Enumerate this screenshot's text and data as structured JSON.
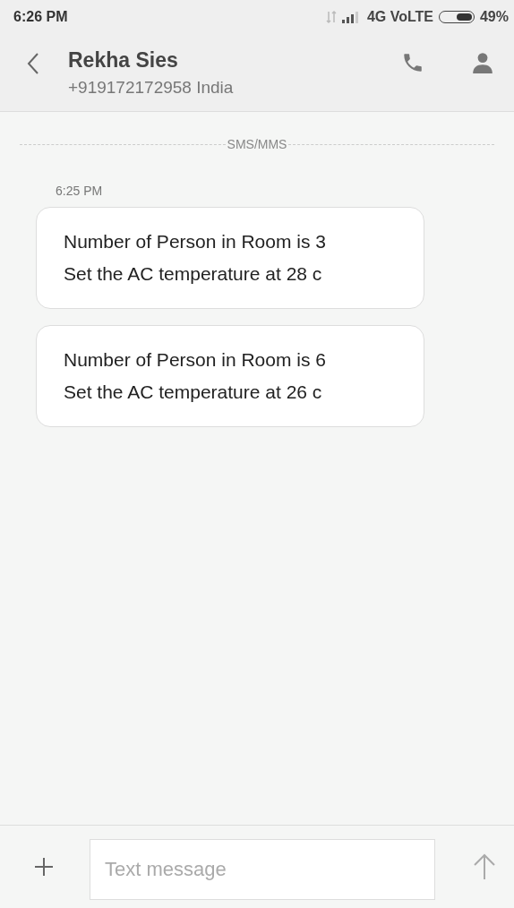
{
  "status_bar": {
    "time": "6:26 PM",
    "network": "4G VoLTE",
    "battery": {
      "label": "49%",
      "level": 0.49
    }
  },
  "header": {
    "name": "Rekha Sies",
    "number": "+919172172958 India"
  },
  "channel_label": "SMS/MMS",
  "timestamp": "6:25 PM",
  "messages": [
    {
      "text": "Number of Person in Room is 3\nSet the AC temperature at 28 c"
    },
    {
      "text": "Number of Person in Room is 6\nSet the AC temperature at 26 c"
    }
  ],
  "composer": {
    "placeholder": "Text message"
  }
}
